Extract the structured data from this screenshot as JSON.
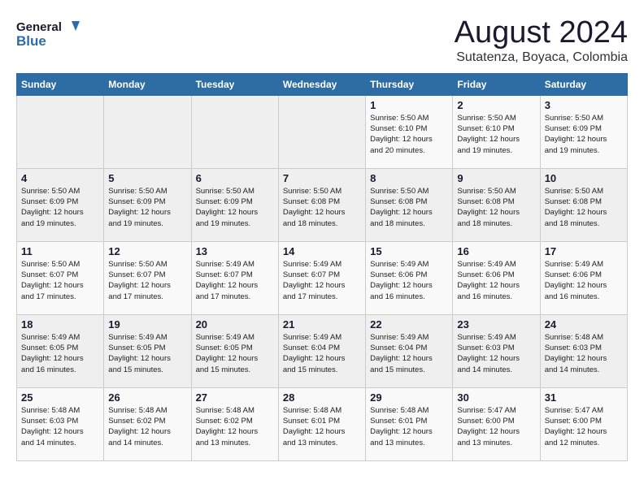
{
  "header": {
    "logo_line1": "General",
    "logo_line2": "Blue",
    "month_year": "August 2024",
    "location": "Sutatenza, Boyaca, Colombia"
  },
  "weekdays": [
    "Sunday",
    "Monday",
    "Tuesday",
    "Wednesday",
    "Thursday",
    "Friday",
    "Saturday"
  ],
  "weeks": [
    [
      {
        "day": "",
        "info": ""
      },
      {
        "day": "",
        "info": ""
      },
      {
        "day": "",
        "info": ""
      },
      {
        "day": "",
        "info": ""
      },
      {
        "day": "1",
        "info": "Sunrise: 5:50 AM\nSunset: 6:10 PM\nDaylight: 12 hours\nand 20 minutes."
      },
      {
        "day": "2",
        "info": "Sunrise: 5:50 AM\nSunset: 6:10 PM\nDaylight: 12 hours\nand 19 minutes."
      },
      {
        "day": "3",
        "info": "Sunrise: 5:50 AM\nSunset: 6:09 PM\nDaylight: 12 hours\nand 19 minutes."
      }
    ],
    [
      {
        "day": "4",
        "info": "Sunrise: 5:50 AM\nSunset: 6:09 PM\nDaylight: 12 hours\nand 19 minutes."
      },
      {
        "day": "5",
        "info": "Sunrise: 5:50 AM\nSunset: 6:09 PM\nDaylight: 12 hours\nand 19 minutes."
      },
      {
        "day": "6",
        "info": "Sunrise: 5:50 AM\nSunset: 6:09 PM\nDaylight: 12 hours\nand 19 minutes."
      },
      {
        "day": "7",
        "info": "Sunrise: 5:50 AM\nSunset: 6:08 PM\nDaylight: 12 hours\nand 18 minutes."
      },
      {
        "day": "8",
        "info": "Sunrise: 5:50 AM\nSunset: 6:08 PM\nDaylight: 12 hours\nand 18 minutes."
      },
      {
        "day": "9",
        "info": "Sunrise: 5:50 AM\nSunset: 6:08 PM\nDaylight: 12 hours\nand 18 minutes."
      },
      {
        "day": "10",
        "info": "Sunrise: 5:50 AM\nSunset: 6:08 PM\nDaylight: 12 hours\nand 18 minutes."
      }
    ],
    [
      {
        "day": "11",
        "info": "Sunrise: 5:50 AM\nSunset: 6:07 PM\nDaylight: 12 hours\nand 17 minutes."
      },
      {
        "day": "12",
        "info": "Sunrise: 5:50 AM\nSunset: 6:07 PM\nDaylight: 12 hours\nand 17 minutes."
      },
      {
        "day": "13",
        "info": "Sunrise: 5:49 AM\nSunset: 6:07 PM\nDaylight: 12 hours\nand 17 minutes."
      },
      {
        "day": "14",
        "info": "Sunrise: 5:49 AM\nSunset: 6:07 PM\nDaylight: 12 hours\nand 17 minutes."
      },
      {
        "day": "15",
        "info": "Sunrise: 5:49 AM\nSunset: 6:06 PM\nDaylight: 12 hours\nand 16 minutes."
      },
      {
        "day": "16",
        "info": "Sunrise: 5:49 AM\nSunset: 6:06 PM\nDaylight: 12 hours\nand 16 minutes."
      },
      {
        "day": "17",
        "info": "Sunrise: 5:49 AM\nSunset: 6:06 PM\nDaylight: 12 hours\nand 16 minutes."
      }
    ],
    [
      {
        "day": "18",
        "info": "Sunrise: 5:49 AM\nSunset: 6:05 PM\nDaylight: 12 hours\nand 16 minutes."
      },
      {
        "day": "19",
        "info": "Sunrise: 5:49 AM\nSunset: 6:05 PM\nDaylight: 12 hours\nand 15 minutes."
      },
      {
        "day": "20",
        "info": "Sunrise: 5:49 AM\nSunset: 6:05 PM\nDaylight: 12 hours\nand 15 minutes."
      },
      {
        "day": "21",
        "info": "Sunrise: 5:49 AM\nSunset: 6:04 PM\nDaylight: 12 hours\nand 15 minutes."
      },
      {
        "day": "22",
        "info": "Sunrise: 5:49 AM\nSunset: 6:04 PM\nDaylight: 12 hours\nand 15 minutes."
      },
      {
        "day": "23",
        "info": "Sunrise: 5:49 AM\nSunset: 6:03 PM\nDaylight: 12 hours\nand 14 minutes."
      },
      {
        "day": "24",
        "info": "Sunrise: 5:48 AM\nSunset: 6:03 PM\nDaylight: 12 hours\nand 14 minutes."
      }
    ],
    [
      {
        "day": "25",
        "info": "Sunrise: 5:48 AM\nSunset: 6:03 PM\nDaylight: 12 hours\nand 14 minutes."
      },
      {
        "day": "26",
        "info": "Sunrise: 5:48 AM\nSunset: 6:02 PM\nDaylight: 12 hours\nand 14 minutes."
      },
      {
        "day": "27",
        "info": "Sunrise: 5:48 AM\nSunset: 6:02 PM\nDaylight: 12 hours\nand 13 minutes."
      },
      {
        "day": "28",
        "info": "Sunrise: 5:48 AM\nSunset: 6:01 PM\nDaylight: 12 hours\nand 13 minutes."
      },
      {
        "day": "29",
        "info": "Sunrise: 5:48 AM\nSunset: 6:01 PM\nDaylight: 12 hours\nand 13 minutes."
      },
      {
        "day": "30",
        "info": "Sunrise: 5:47 AM\nSunset: 6:00 PM\nDaylight: 12 hours\nand 13 minutes."
      },
      {
        "day": "31",
        "info": "Sunrise: 5:47 AM\nSunset: 6:00 PM\nDaylight: 12 hours\nand 12 minutes."
      }
    ]
  ]
}
